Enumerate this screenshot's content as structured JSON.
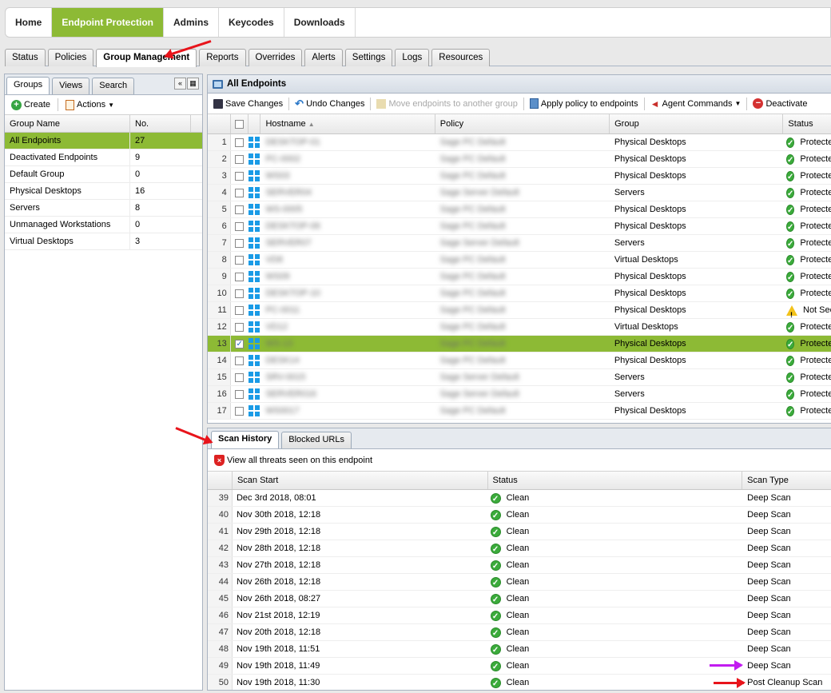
{
  "topnav": [
    {
      "label": "Home",
      "active": false
    },
    {
      "label": "Endpoint Protection",
      "active": true
    },
    {
      "label": "Admins",
      "active": false
    },
    {
      "label": "Keycodes",
      "active": false
    },
    {
      "label": "Downloads",
      "active": false
    }
  ],
  "subtabs": [
    "Status",
    "Policies",
    "Group Management",
    "Reports",
    "Overrides",
    "Alerts",
    "Settings",
    "Logs",
    "Resources"
  ],
  "subtabs_active": "Group Management",
  "left": {
    "tabs": [
      "Groups",
      "Views",
      "Search"
    ],
    "toolbar": {
      "create": "Create",
      "actions": "Actions"
    },
    "headers": {
      "name": "Group Name",
      "count": "No."
    },
    "groups": [
      {
        "name": "All Endpoints",
        "count": "27",
        "selected": true
      },
      {
        "name": "Deactivated Endpoints",
        "count": "9"
      },
      {
        "name": "Default Group",
        "count": "0"
      },
      {
        "name": "Physical Desktops",
        "count": "16"
      },
      {
        "name": "Servers",
        "count": "8"
      },
      {
        "name": "Unmanaged Workstations",
        "count": "0"
      },
      {
        "name": "Virtual Desktops",
        "count": "3"
      }
    ]
  },
  "endpoints": {
    "title": "All Endpoints",
    "toolbar": {
      "save": "Save Changes",
      "undo": "Undo Changes",
      "move": "Move endpoints to another group",
      "apply": "Apply policy to endpoints",
      "agent": "Agent Commands",
      "deactivate": "Deactivate"
    },
    "headers": {
      "hostname": "Hostname",
      "policy": "Policy",
      "group": "Group",
      "status": "Status"
    },
    "rows": [
      {
        "n": "1",
        "host": "DESKTOP-01",
        "policy": "Sage PC Default",
        "group": "Physical Desktops",
        "status": "Protected",
        "state": "ok"
      },
      {
        "n": "2",
        "host": "PC-0002",
        "policy": "Sage PC Default",
        "group": "Physical Desktops",
        "status": "Protected",
        "state": "ok"
      },
      {
        "n": "3",
        "host": "WS03",
        "policy": "Sage PC Default",
        "group": "Physical Desktops",
        "status": "Protected",
        "state": "ok"
      },
      {
        "n": "4",
        "host": "SERVER04",
        "policy": "Sage Server Default",
        "group": "Servers",
        "status": "Protected",
        "state": "ok"
      },
      {
        "n": "5",
        "host": "WS-0005",
        "policy": "Sage PC Default",
        "group": "Physical Desktops",
        "status": "Protected",
        "state": "ok"
      },
      {
        "n": "6",
        "host": "DESKTOP-06",
        "policy": "Sage PC Default",
        "group": "Physical Desktops",
        "status": "Protected",
        "state": "ok"
      },
      {
        "n": "7",
        "host": "SERVER07",
        "policy": "Sage Server Default",
        "group": "Servers",
        "status": "Protected",
        "state": "ok"
      },
      {
        "n": "8",
        "host": "VD8",
        "policy": "Sage PC Default",
        "group": "Virtual Desktops",
        "status": "Protected",
        "state": "ok"
      },
      {
        "n": "9",
        "host": "WS09",
        "policy": "Sage PC Default",
        "group": "Physical Desktops",
        "status": "Protected",
        "state": "ok"
      },
      {
        "n": "10",
        "host": "DESKTOP-10",
        "policy": "Sage PC Default",
        "group": "Physical Desktops",
        "status": "Protected",
        "state": "ok"
      },
      {
        "n": "11",
        "host": "PC-0011",
        "policy": "Sage PC Default",
        "group": "Physical Desktops",
        "status": "Not Seen",
        "state": "warn"
      },
      {
        "n": "12",
        "host": "VD12",
        "policy": "Sage PC Default",
        "group": "Virtual Desktops",
        "status": "Protected",
        "state": "ok"
      },
      {
        "n": "13",
        "host": "WS-13",
        "policy": "Sage PC Default",
        "group": "Physical Desktops",
        "status": "Protected",
        "state": "ok",
        "selected": true
      },
      {
        "n": "14",
        "host": "DESK14",
        "policy": "Sage PC Default",
        "group": "Physical Desktops",
        "status": "Protected",
        "state": "ok"
      },
      {
        "n": "15",
        "host": "SRV-0015",
        "policy": "Sage Server Default",
        "group": "Servers",
        "status": "Protected",
        "state": "ok"
      },
      {
        "n": "16",
        "host": "SERVER016",
        "policy": "Sage Server Default",
        "group": "Servers",
        "status": "Protected",
        "state": "ok"
      },
      {
        "n": "17",
        "host": "WS0017",
        "policy": "Sage PC Default",
        "group": "Physical Desktops",
        "status": "Protected",
        "state": "ok"
      }
    ]
  },
  "scan": {
    "tabs": [
      "Scan History",
      "Blocked URLs"
    ],
    "link": "View all threats seen on this endpoint",
    "headers": {
      "start": "Scan Start",
      "status": "Status",
      "type": "Scan Type"
    },
    "rows": [
      {
        "n": "39",
        "start": "Dec 3rd 2018, 08:01",
        "status": "Clean",
        "type": "Deep Scan"
      },
      {
        "n": "40",
        "start": "Nov 30th 2018, 12:18",
        "status": "Clean",
        "type": "Deep Scan"
      },
      {
        "n": "41",
        "start": "Nov 29th 2018, 12:18",
        "status": "Clean",
        "type": "Deep Scan"
      },
      {
        "n": "42",
        "start": "Nov 28th 2018, 12:18",
        "status": "Clean",
        "type": "Deep Scan"
      },
      {
        "n": "43",
        "start": "Nov 27th 2018, 12:18",
        "status": "Clean",
        "type": "Deep Scan"
      },
      {
        "n": "44",
        "start": "Nov 26th 2018, 12:18",
        "status": "Clean",
        "type": "Deep Scan"
      },
      {
        "n": "45",
        "start": "Nov 26th 2018, 08:27",
        "status": "Clean",
        "type": "Deep Scan"
      },
      {
        "n": "46",
        "start": "Nov 21st 2018, 12:19",
        "status": "Clean",
        "type": "Deep Scan"
      },
      {
        "n": "47",
        "start": "Nov 20th 2018, 12:18",
        "status": "Clean",
        "type": "Deep Scan"
      },
      {
        "n": "48",
        "start": "Nov 19th 2018, 11:51",
        "status": "Clean",
        "type": "Deep Scan"
      },
      {
        "n": "49",
        "start": "Nov 19th 2018, 11:49",
        "status": "Clean",
        "type": "Deep Scan"
      },
      {
        "n": "50",
        "start": "Nov 19th 2018, 11:30",
        "status": "Clean",
        "type": "Post Cleanup Scan"
      }
    ]
  },
  "colors": {
    "accent": "#8dba35",
    "ok": "#3bab3b",
    "warn": "#f2c21a",
    "arrow_red": "#e8141b",
    "arrow_purple": "#c21cf0"
  }
}
